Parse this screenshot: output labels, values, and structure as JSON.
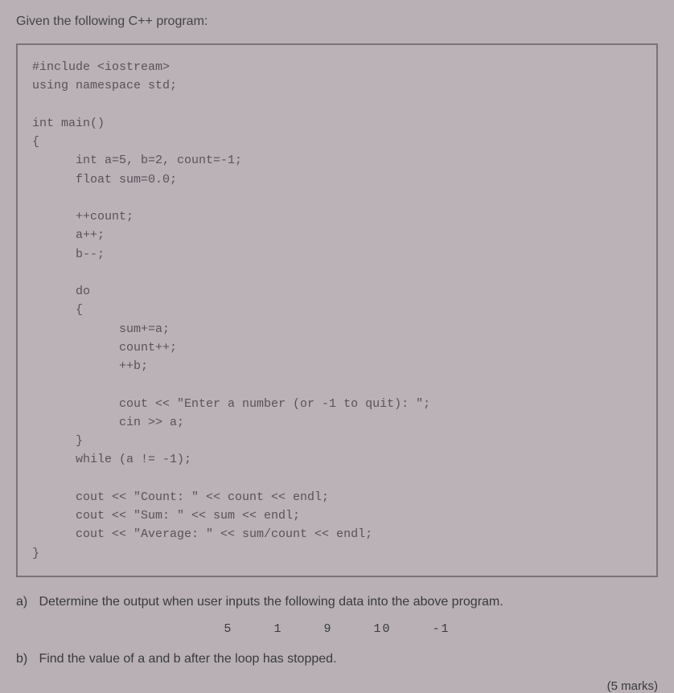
{
  "intro": "Given the following C++ program:",
  "code": "#include <iostream>\nusing namespace std;\n\nint main()\n{\n      int a=5, b=2, count=-1;\n      float sum=0.0;\n\n      ++count;\n      a++;\n      b--;\n\n      do\n      {\n            sum+=a;\n            count++;\n            ++b;\n\n            cout << \"Enter a number (or -1 to quit): \";\n            cin >> a;\n      }\n      while (a != -1);\n\n      cout << \"Count: \" << count << endl;\n      cout << \"Sum: \" << sum << endl;\n      cout << \"Average: \" << sum/count << endl;\n}",
  "parts": {
    "a": {
      "label": "a)",
      "text": "Determine the output when user inputs the following data into the above program."
    },
    "b": {
      "label": "b)",
      "text": "Find the value of a and b after the loop has stopped."
    }
  },
  "input_data": [
    "5",
    "1",
    "9",
    "10",
    "-1"
  ],
  "marks": "(5 marks)"
}
